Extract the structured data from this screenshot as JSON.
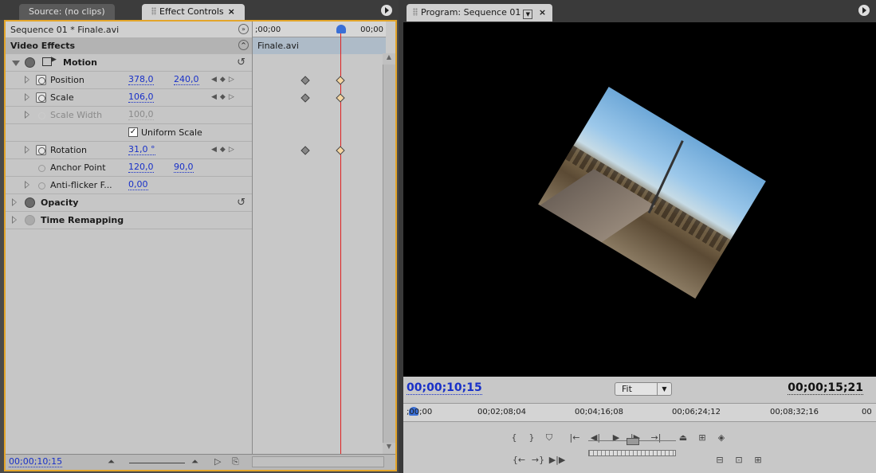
{
  "left_panel": {
    "tabs": [
      {
        "label": "Source: (no clips)"
      },
      {
        "label": "Effect Controls",
        "close": "×"
      }
    ],
    "sequence_label": "Sequence 01 * Finale.avi",
    "video_effects_label": "Video Effects",
    "timeline": {
      "start": ";00;00",
      "end": "00;00",
      "clip_label": "Finale.avi"
    },
    "motion": {
      "label": "Motion",
      "properties": {
        "position": {
          "label": "Position",
          "x": "378,0",
          "y": "240,0"
        },
        "scale": {
          "label": "Scale",
          "value": "106,0"
        },
        "scale_width": {
          "label": "Scale Width",
          "value": "100,0"
        },
        "uniform_scale": {
          "label": "Uniform Scale",
          "checked": true
        },
        "rotation": {
          "label": "Rotation",
          "value": "31,0 °"
        },
        "anchor_point": {
          "label": "Anchor Point",
          "x": "120,0",
          "y": "90,0"
        },
        "anti_flicker": {
          "label": "Anti-flicker F...",
          "value": "0,00"
        }
      }
    },
    "opacity_label": "Opacity",
    "time_remapping_label": "Time Remapping",
    "bottom_timecode": "00;00;10;15"
  },
  "right_panel": {
    "tab_label": "Program: Sequence 01",
    "tab_close": "×",
    "current_timecode": "00;00;10;15",
    "duration_timecode": "00;00;15;21",
    "zoom": "Fit",
    "ruler_labels": [
      ";00;00",
      "00;02;08;04",
      "00;04;16;08",
      "00;06;24;12",
      "00;08;32;16",
      "00"
    ]
  },
  "colors": {
    "accent_border": "#e3a52a",
    "timecode_blue": "#1830c8",
    "playhead_red": "#e02020"
  }
}
